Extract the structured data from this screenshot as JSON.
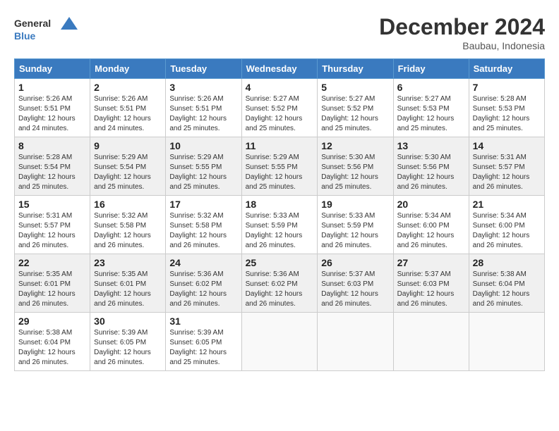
{
  "header": {
    "logo_line1": "General",
    "logo_line2": "Blue",
    "title": "December 2024",
    "location": "Baubau, Indonesia"
  },
  "weekdays": [
    "Sunday",
    "Monday",
    "Tuesday",
    "Wednesday",
    "Thursday",
    "Friday",
    "Saturday"
  ],
  "weeks": [
    [
      {
        "day": "1",
        "info": "Sunrise: 5:26 AM\nSunset: 5:51 PM\nDaylight: 12 hours\nand 24 minutes."
      },
      {
        "day": "2",
        "info": "Sunrise: 5:26 AM\nSunset: 5:51 PM\nDaylight: 12 hours\nand 24 minutes."
      },
      {
        "day": "3",
        "info": "Sunrise: 5:26 AM\nSunset: 5:51 PM\nDaylight: 12 hours\nand 25 minutes."
      },
      {
        "day": "4",
        "info": "Sunrise: 5:27 AM\nSunset: 5:52 PM\nDaylight: 12 hours\nand 25 minutes."
      },
      {
        "day": "5",
        "info": "Sunrise: 5:27 AM\nSunset: 5:52 PM\nDaylight: 12 hours\nand 25 minutes."
      },
      {
        "day": "6",
        "info": "Sunrise: 5:27 AM\nSunset: 5:53 PM\nDaylight: 12 hours\nand 25 minutes."
      },
      {
        "day": "7",
        "info": "Sunrise: 5:28 AM\nSunset: 5:53 PM\nDaylight: 12 hours\nand 25 minutes."
      }
    ],
    [
      {
        "day": "8",
        "info": "Sunrise: 5:28 AM\nSunset: 5:54 PM\nDaylight: 12 hours\nand 25 minutes."
      },
      {
        "day": "9",
        "info": "Sunrise: 5:29 AM\nSunset: 5:54 PM\nDaylight: 12 hours\nand 25 minutes."
      },
      {
        "day": "10",
        "info": "Sunrise: 5:29 AM\nSunset: 5:55 PM\nDaylight: 12 hours\nand 25 minutes."
      },
      {
        "day": "11",
        "info": "Sunrise: 5:29 AM\nSunset: 5:55 PM\nDaylight: 12 hours\nand 25 minutes."
      },
      {
        "day": "12",
        "info": "Sunrise: 5:30 AM\nSunset: 5:56 PM\nDaylight: 12 hours\nand 25 minutes."
      },
      {
        "day": "13",
        "info": "Sunrise: 5:30 AM\nSunset: 5:56 PM\nDaylight: 12 hours\nand 26 minutes."
      },
      {
        "day": "14",
        "info": "Sunrise: 5:31 AM\nSunset: 5:57 PM\nDaylight: 12 hours\nand 26 minutes."
      }
    ],
    [
      {
        "day": "15",
        "info": "Sunrise: 5:31 AM\nSunset: 5:57 PM\nDaylight: 12 hours\nand 26 minutes."
      },
      {
        "day": "16",
        "info": "Sunrise: 5:32 AM\nSunset: 5:58 PM\nDaylight: 12 hours\nand 26 minutes."
      },
      {
        "day": "17",
        "info": "Sunrise: 5:32 AM\nSunset: 5:58 PM\nDaylight: 12 hours\nand 26 minutes."
      },
      {
        "day": "18",
        "info": "Sunrise: 5:33 AM\nSunset: 5:59 PM\nDaylight: 12 hours\nand 26 minutes."
      },
      {
        "day": "19",
        "info": "Sunrise: 5:33 AM\nSunset: 5:59 PM\nDaylight: 12 hours\nand 26 minutes."
      },
      {
        "day": "20",
        "info": "Sunrise: 5:34 AM\nSunset: 6:00 PM\nDaylight: 12 hours\nand 26 minutes."
      },
      {
        "day": "21",
        "info": "Sunrise: 5:34 AM\nSunset: 6:00 PM\nDaylight: 12 hours\nand 26 minutes."
      }
    ],
    [
      {
        "day": "22",
        "info": "Sunrise: 5:35 AM\nSunset: 6:01 PM\nDaylight: 12 hours\nand 26 minutes."
      },
      {
        "day": "23",
        "info": "Sunrise: 5:35 AM\nSunset: 6:01 PM\nDaylight: 12 hours\nand 26 minutes."
      },
      {
        "day": "24",
        "info": "Sunrise: 5:36 AM\nSunset: 6:02 PM\nDaylight: 12 hours\nand 26 minutes."
      },
      {
        "day": "25",
        "info": "Sunrise: 5:36 AM\nSunset: 6:02 PM\nDaylight: 12 hours\nand 26 minutes."
      },
      {
        "day": "26",
        "info": "Sunrise: 5:37 AM\nSunset: 6:03 PM\nDaylight: 12 hours\nand 26 minutes."
      },
      {
        "day": "27",
        "info": "Sunrise: 5:37 AM\nSunset: 6:03 PM\nDaylight: 12 hours\nand 26 minutes."
      },
      {
        "day": "28",
        "info": "Sunrise: 5:38 AM\nSunset: 6:04 PM\nDaylight: 12 hours\nand 26 minutes."
      }
    ],
    [
      {
        "day": "29",
        "info": "Sunrise: 5:38 AM\nSunset: 6:04 PM\nDaylight: 12 hours\nand 26 minutes."
      },
      {
        "day": "30",
        "info": "Sunrise: 5:39 AM\nSunset: 6:05 PM\nDaylight: 12 hours\nand 26 minutes."
      },
      {
        "day": "31",
        "info": "Sunrise: 5:39 AM\nSunset: 6:05 PM\nDaylight: 12 hours\nand 25 minutes."
      },
      null,
      null,
      null,
      null
    ]
  ]
}
